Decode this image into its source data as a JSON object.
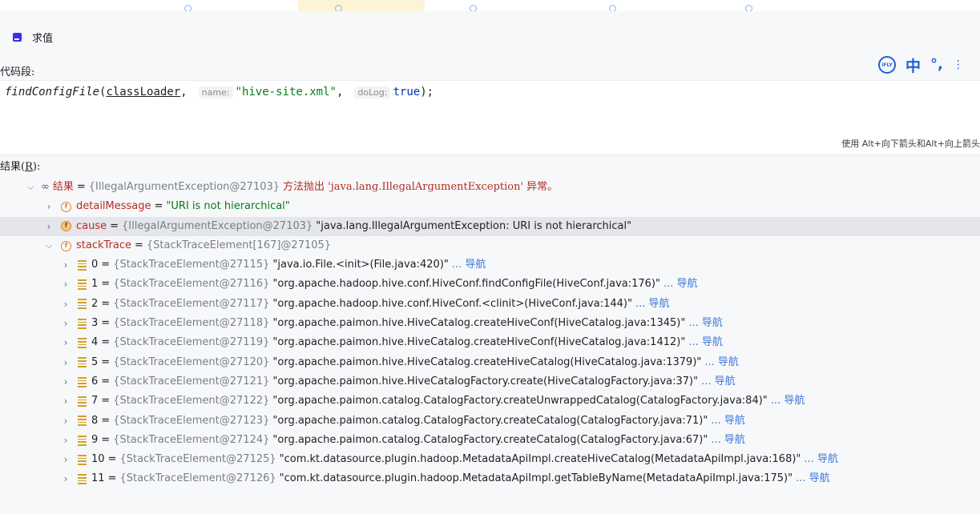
{
  "dialog": {
    "title": "求值",
    "code_label": "代码段:",
    "result_label_prefix": "结果(",
    "result_label_mnemonic": "R",
    "result_label_suffix": "):"
  },
  "ime": {
    "logo": "iFLY",
    "zh": "中",
    "punct": "°,",
    "more": "⋮"
  },
  "editor": {
    "method": "findConfigFile",
    "open": "(",
    "arg1": "classLoader",
    "comma": ",",
    "hint_name": "name:",
    "str_value": "\"hive-site.xml\"",
    "hint_dolog": "doLog:",
    "bool_value": "true",
    "close": ");"
  },
  "hint_text": "使用 Alt+向下箭头和Alt+向上箭头",
  "tree": {
    "root": {
      "name": "结果",
      "type": "{IllegalArgumentException@27103}",
      "msg": "方法抛出 'java.lang.IllegalArgumentException' 异常。"
    },
    "detail_message": {
      "name": "detailMessage",
      "value": "\"URI is not hierarchical\""
    },
    "cause": {
      "name": "cause",
      "type": "{IllegalArgumentException@27103}",
      "value": "\"java.lang.IllegalArgumentException: URI is not hierarchical\""
    },
    "stack_trace": {
      "name": "stackTrace",
      "type": "{StackTraceElement[167]@27105}"
    },
    "nav_label": "导航",
    "elements": [
      {
        "index": "0",
        "type": "{StackTraceElement@27115}",
        "value": "\"java.io.File.<init>(File.java:420)\""
      },
      {
        "index": "1",
        "type": "{StackTraceElement@27116}",
        "value": "\"org.apache.hadoop.hive.conf.HiveConf.findConfigFile(HiveConf.java:176)\""
      },
      {
        "index": "2",
        "type": "{StackTraceElement@27117}",
        "value": "\"org.apache.hadoop.hive.conf.HiveConf.<clinit>(HiveConf.java:144)\""
      },
      {
        "index": "3",
        "type": "{StackTraceElement@27118}",
        "value": "\"org.apache.paimon.hive.HiveCatalog.createHiveConf(HiveCatalog.java:1345)\""
      },
      {
        "index": "4",
        "type": "{StackTraceElement@27119}",
        "value": "\"org.apache.paimon.hive.HiveCatalog.createHiveConf(HiveCatalog.java:1412)\""
      },
      {
        "index": "5",
        "type": "{StackTraceElement@27120}",
        "value": "\"org.apache.paimon.hive.HiveCatalog.createHiveCatalog(HiveCatalog.java:1379)\""
      },
      {
        "index": "6",
        "type": "{StackTraceElement@27121}",
        "value": "\"org.apache.paimon.hive.HiveCatalogFactory.create(HiveCatalogFactory.java:37)\""
      },
      {
        "index": "7",
        "type": "{StackTraceElement@27122}",
        "value": "\"org.apache.paimon.catalog.CatalogFactory.createUnwrappedCatalog(CatalogFactory.java:84)\""
      },
      {
        "index": "8",
        "type": "{StackTraceElement@27123}",
        "value": "\"org.apache.paimon.catalog.CatalogFactory.createCatalog(CatalogFactory.java:71)\""
      },
      {
        "index": "9",
        "type": "{StackTraceElement@27124}",
        "value": "\"org.apache.paimon.catalog.CatalogFactory.createCatalog(CatalogFactory.java:67)\""
      },
      {
        "index": "10",
        "type": "{StackTraceElement@27125}",
        "value": "\"com.kt.datasource.plugin.hadoop.MetadataApiImpl.createHiveCatalog(MetadataApiImpl.java:168)\""
      },
      {
        "index": "11",
        "type": "{StackTraceElement@27126}",
        "value": "\"com.kt.datasource.plugin.hadoop.MetadataApiImpl.getTableByName(MetadataApiImpl.java:175)\""
      }
    ]
  }
}
